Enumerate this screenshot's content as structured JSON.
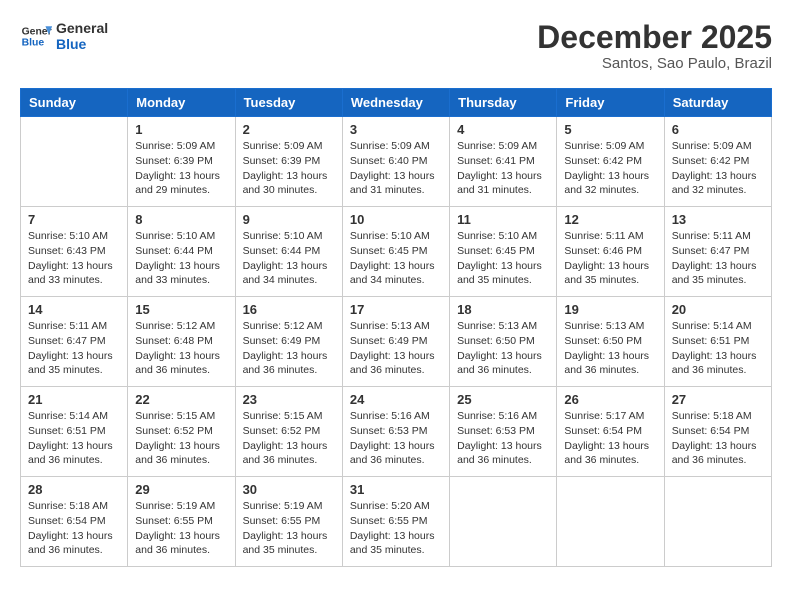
{
  "header": {
    "logo_line1": "General",
    "logo_line2": "Blue",
    "month_year": "December 2025",
    "location": "Santos, Sao Paulo, Brazil"
  },
  "days_of_week": [
    "Sunday",
    "Monday",
    "Tuesday",
    "Wednesday",
    "Thursday",
    "Friday",
    "Saturday"
  ],
  "weeks": [
    [
      {
        "day": "",
        "info": ""
      },
      {
        "day": "1",
        "info": "Sunrise: 5:09 AM\nSunset: 6:39 PM\nDaylight: 13 hours\nand 29 minutes."
      },
      {
        "day": "2",
        "info": "Sunrise: 5:09 AM\nSunset: 6:39 PM\nDaylight: 13 hours\nand 30 minutes."
      },
      {
        "day": "3",
        "info": "Sunrise: 5:09 AM\nSunset: 6:40 PM\nDaylight: 13 hours\nand 31 minutes."
      },
      {
        "day": "4",
        "info": "Sunrise: 5:09 AM\nSunset: 6:41 PM\nDaylight: 13 hours\nand 31 minutes."
      },
      {
        "day": "5",
        "info": "Sunrise: 5:09 AM\nSunset: 6:42 PM\nDaylight: 13 hours\nand 32 minutes."
      },
      {
        "day": "6",
        "info": "Sunrise: 5:09 AM\nSunset: 6:42 PM\nDaylight: 13 hours\nand 32 minutes."
      }
    ],
    [
      {
        "day": "7",
        "info": "Sunrise: 5:10 AM\nSunset: 6:43 PM\nDaylight: 13 hours\nand 33 minutes."
      },
      {
        "day": "8",
        "info": "Sunrise: 5:10 AM\nSunset: 6:44 PM\nDaylight: 13 hours\nand 33 minutes."
      },
      {
        "day": "9",
        "info": "Sunrise: 5:10 AM\nSunset: 6:44 PM\nDaylight: 13 hours\nand 34 minutes."
      },
      {
        "day": "10",
        "info": "Sunrise: 5:10 AM\nSunset: 6:45 PM\nDaylight: 13 hours\nand 34 minutes."
      },
      {
        "day": "11",
        "info": "Sunrise: 5:10 AM\nSunset: 6:45 PM\nDaylight: 13 hours\nand 35 minutes."
      },
      {
        "day": "12",
        "info": "Sunrise: 5:11 AM\nSunset: 6:46 PM\nDaylight: 13 hours\nand 35 minutes."
      },
      {
        "day": "13",
        "info": "Sunrise: 5:11 AM\nSunset: 6:47 PM\nDaylight: 13 hours\nand 35 minutes."
      }
    ],
    [
      {
        "day": "14",
        "info": "Sunrise: 5:11 AM\nSunset: 6:47 PM\nDaylight: 13 hours\nand 35 minutes."
      },
      {
        "day": "15",
        "info": "Sunrise: 5:12 AM\nSunset: 6:48 PM\nDaylight: 13 hours\nand 36 minutes."
      },
      {
        "day": "16",
        "info": "Sunrise: 5:12 AM\nSunset: 6:49 PM\nDaylight: 13 hours\nand 36 minutes."
      },
      {
        "day": "17",
        "info": "Sunrise: 5:13 AM\nSunset: 6:49 PM\nDaylight: 13 hours\nand 36 minutes."
      },
      {
        "day": "18",
        "info": "Sunrise: 5:13 AM\nSunset: 6:50 PM\nDaylight: 13 hours\nand 36 minutes."
      },
      {
        "day": "19",
        "info": "Sunrise: 5:13 AM\nSunset: 6:50 PM\nDaylight: 13 hours\nand 36 minutes."
      },
      {
        "day": "20",
        "info": "Sunrise: 5:14 AM\nSunset: 6:51 PM\nDaylight: 13 hours\nand 36 minutes."
      }
    ],
    [
      {
        "day": "21",
        "info": "Sunrise: 5:14 AM\nSunset: 6:51 PM\nDaylight: 13 hours\nand 36 minutes."
      },
      {
        "day": "22",
        "info": "Sunrise: 5:15 AM\nSunset: 6:52 PM\nDaylight: 13 hours\nand 36 minutes."
      },
      {
        "day": "23",
        "info": "Sunrise: 5:15 AM\nSunset: 6:52 PM\nDaylight: 13 hours\nand 36 minutes."
      },
      {
        "day": "24",
        "info": "Sunrise: 5:16 AM\nSunset: 6:53 PM\nDaylight: 13 hours\nand 36 minutes."
      },
      {
        "day": "25",
        "info": "Sunrise: 5:16 AM\nSunset: 6:53 PM\nDaylight: 13 hours\nand 36 minutes."
      },
      {
        "day": "26",
        "info": "Sunrise: 5:17 AM\nSunset: 6:54 PM\nDaylight: 13 hours\nand 36 minutes."
      },
      {
        "day": "27",
        "info": "Sunrise: 5:18 AM\nSunset: 6:54 PM\nDaylight: 13 hours\nand 36 minutes."
      }
    ],
    [
      {
        "day": "28",
        "info": "Sunrise: 5:18 AM\nSunset: 6:54 PM\nDaylight: 13 hours\nand 36 minutes."
      },
      {
        "day": "29",
        "info": "Sunrise: 5:19 AM\nSunset: 6:55 PM\nDaylight: 13 hours\nand 36 minutes."
      },
      {
        "day": "30",
        "info": "Sunrise: 5:19 AM\nSunset: 6:55 PM\nDaylight: 13 hours\nand 35 minutes."
      },
      {
        "day": "31",
        "info": "Sunrise: 5:20 AM\nSunset: 6:55 PM\nDaylight: 13 hours\nand 35 minutes."
      },
      {
        "day": "",
        "info": ""
      },
      {
        "day": "",
        "info": ""
      },
      {
        "day": "",
        "info": ""
      }
    ]
  ]
}
